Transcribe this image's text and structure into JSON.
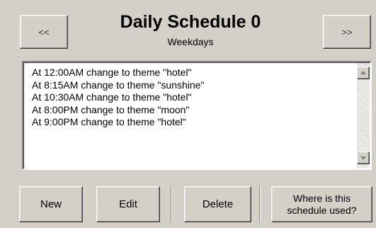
{
  "header": {
    "prev_label": "<<",
    "next_label": ">>",
    "title": "Daily Schedule 0",
    "subtitle": "Weekdays"
  },
  "schedule": {
    "entries": [
      "At 12:00AM change to theme \"hotel\"",
      "At 8:15AM change to theme \"sunshine\"",
      "At 10:30AM change to theme \"hotel\"",
      "At 8:00PM change to theme \"moon\"",
      "At 9:00PM change to theme \"hotel\""
    ]
  },
  "actions": {
    "new_label": "New",
    "edit_label": "Edit",
    "delete_label": "Delete",
    "where_used_line1": "Where is this",
    "where_used_line2": "schedule used?"
  },
  "colors": {
    "background": "#d4d0c8",
    "list_background": "#ffffff",
    "text": "#000000"
  }
}
